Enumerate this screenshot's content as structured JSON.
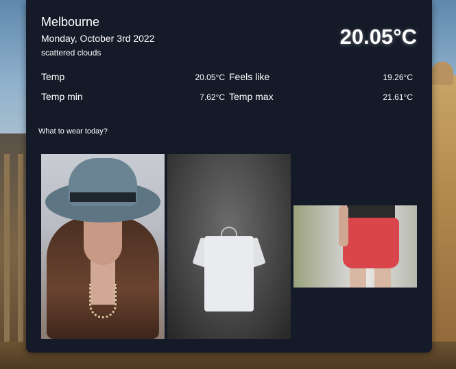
{
  "weather": {
    "city": "Melbourne",
    "date": "Monday, October 3rd 2022",
    "description": "scattered clouds",
    "current_temp": "20.05°C"
  },
  "stats": {
    "temp_label": "Temp",
    "temp_value": "20.05°C",
    "feels_like_label": "Feels like",
    "feels_like_value": "19.26°C",
    "temp_min_label": "Temp min",
    "temp_min_value": "7.62°C",
    "temp_max_label": "Temp max",
    "temp_max_value": "21.61°C"
  },
  "wear": {
    "heading": "What to wear today?",
    "items": [
      {
        "icon": "hat-photo"
      },
      {
        "icon": "tshirt-photo"
      },
      {
        "icon": "shorts-photo"
      }
    ]
  },
  "colors": {
    "card_bg": "#141a28",
    "text": "#ffffff"
  }
}
